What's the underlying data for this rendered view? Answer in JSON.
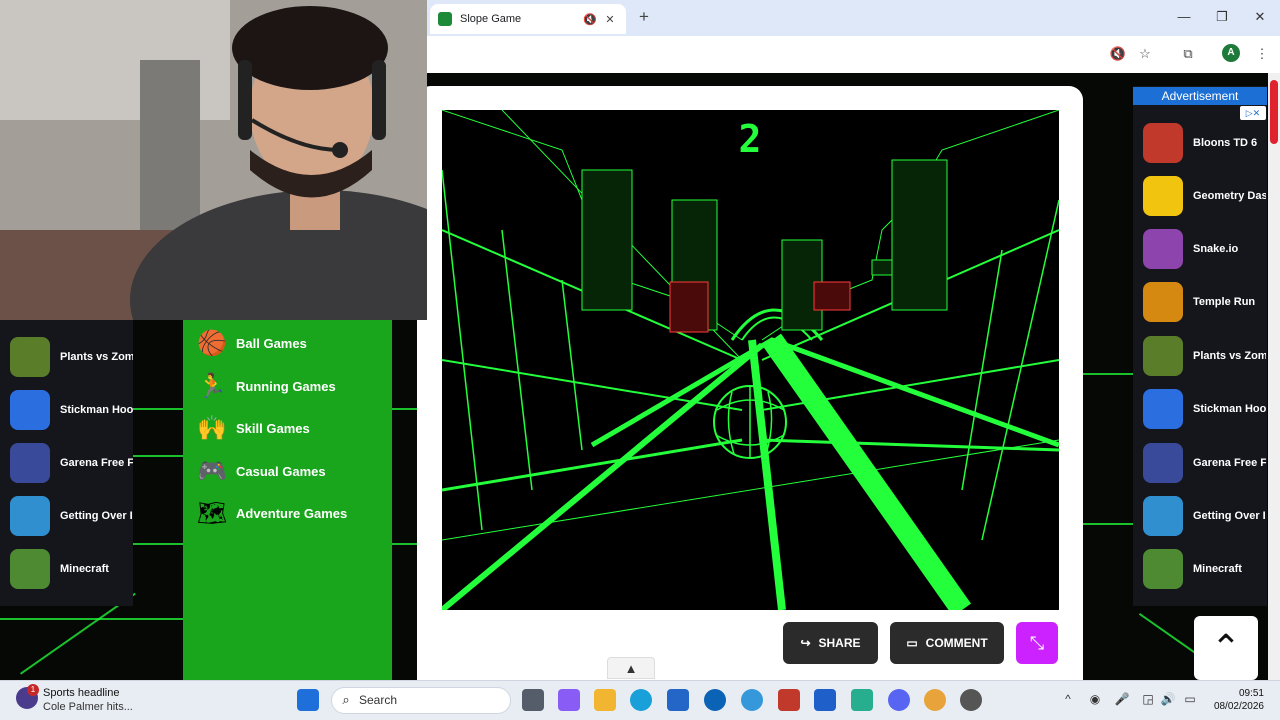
{
  "browser": {
    "tab_title": "Slope Game",
    "mute_icon": "speaker-muted-icon",
    "close_icon": "close-icon",
    "new_tab_icon": "plus-icon",
    "profile_initial": "A"
  },
  "game": {
    "score": "2",
    "actions": {
      "share_label": "SHARE",
      "comment_label": "COMMENT"
    },
    "accent_color": "#23ff3a",
    "fullscreen_color": "#cc22ff"
  },
  "left_list": [
    {
      "label": "Plants vs Zom",
      "color": "#5a7d2a"
    },
    {
      "label": "Stickman Hoo",
      "color": "#2a6ee0"
    },
    {
      "label": "Garena Free F",
      "color": "#3a4a9a"
    },
    {
      "label": "Getting Over I",
      "color": "#2f8fcf"
    },
    {
      "label": "Minecraft",
      "color": "#4e8a32"
    }
  ],
  "categories": [
    {
      "label": "Ball Games",
      "icon": "basketball-icon"
    },
    {
      "label": "Running Games",
      "icon": "runner-icon"
    },
    {
      "label": "Skill Games",
      "icon": "trophy-hands-icon"
    },
    {
      "label": "Casual Games",
      "icon": "gamepad-icon"
    },
    {
      "label": "Adventure Games",
      "icon": "treasure-map-icon"
    }
  ],
  "ad": {
    "header": "Advertisement",
    "items": [
      {
        "label": "Bloons TD 6",
        "color": "#c0392b"
      },
      {
        "label": "Geometry Das",
        "color": "#f1c40f"
      },
      {
        "label": "Snake.io",
        "color": "#8e44ad"
      },
      {
        "label": "Temple Run",
        "color": "#d68910"
      },
      {
        "label": "Plants vs Zom",
        "color": "#5a7d2a"
      },
      {
        "label": "Stickman Hoo",
        "color": "#2a6ee0"
      },
      {
        "label": "Garena Free F",
        "color": "#3a4a9a"
      },
      {
        "label": "Getting Over I",
        "color": "#2f8fcf"
      },
      {
        "label": "Minecraft",
        "color": "#4e8a32"
      }
    ]
  },
  "taskbar": {
    "news_title": "Sports headline",
    "news_subtitle": "Cole Palmer hits...",
    "news_badge": "1",
    "search_placeholder": "Search",
    "time": "09:51",
    "date": "08/02/2026"
  }
}
